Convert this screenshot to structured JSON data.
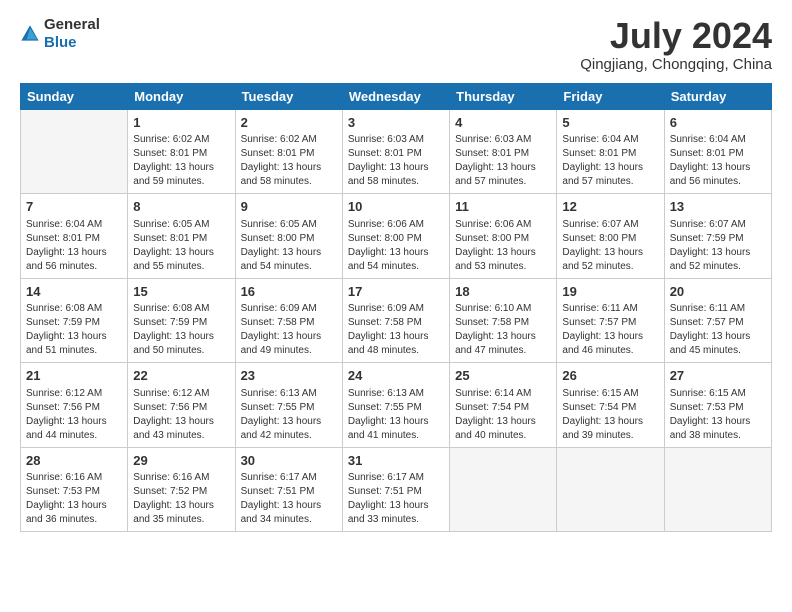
{
  "header": {
    "logo_general": "General",
    "logo_blue": "Blue",
    "month_year": "July 2024",
    "location": "Qingjiang, Chongqing, China"
  },
  "weekdays": [
    "Sunday",
    "Monday",
    "Tuesday",
    "Wednesday",
    "Thursday",
    "Friday",
    "Saturday"
  ],
  "weeks": [
    [
      {
        "day": "",
        "info": ""
      },
      {
        "day": "1",
        "info": "Sunrise: 6:02 AM\nSunset: 8:01 PM\nDaylight: 13 hours\nand 59 minutes."
      },
      {
        "day": "2",
        "info": "Sunrise: 6:02 AM\nSunset: 8:01 PM\nDaylight: 13 hours\nand 58 minutes."
      },
      {
        "day": "3",
        "info": "Sunrise: 6:03 AM\nSunset: 8:01 PM\nDaylight: 13 hours\nand 58 minutes."
      },
      {
        "day": "4",
        "info": "Sunrise: 6:03 AM\nSunset: 8:01 PM\nDaylight: 13 hours\nand 57 minutes."
      },
      {
        "day": "5",
        "info": "Sunrise: 6:04 AM\nSunset: 8:01 PM\nDaylight: 13 hours\nand 57 minutes."
      },
      {
        "day": "6",
        "info": "Sunrise: 6:04 AM\nSunset: 8:01 PM\nDaylight: 13 hours\nand 56 minutes."
      }
    ],
    [
      {
        "day": "7",
        "info": "Sunrise: 6:04 AM\nSunset: 8:01 PM\nDaylight: 13 hours\nand 56 minutes."
      },
      {
        "day": "8",
        "info": "Sunrise: 6:05 AM\nSunset: 8:01 PM\nDaylight: 13 hours\nand 55 minutes."
      },
      {
        "day": "9",
        "info": "Sunrise: 6:05 AM\nSunset: 8:00 PM\nDaylight: 13 hours\nand 54 minutes."
      },
      {
        "day": "10",
        "info": "Sunrise: 6:06 AM\nSunset: 8:00 PM\nDaylight: 13 hours\nand 54 minutes."
      },
      {
        "day": "11",
        "info": "Sunrise: 6:06 AM\nSunset: 8:00 PM\nDaylight: 13 hours\nand 53 minutes."
      },
      {
        "day": "12",
        "info": "Sunrise: 6:07 AM\nSunset: 8:00 PM\nDaylight: 13 hours\nand 52 minutes."
      },
      {
        "day": "13",
        "info": "Sunrise: 6:07 AM\nSunset: 7:59 PM\nDaylight: 13 hours\nand 52 minutes."
      }
    ],
    [
      {
        "day": "14",
        "info": "Sunrise: 6:08 AM\nSunset: 7:59 PM\nDaylight: 13 hours\nand 51 minutes."
      },
      {
        "day": "15",
        "info": "Sunrise: 6:08 AM\nSunset: 7:59 PM\nDaylight: 13 hours\nand 50 minutes."
      },
      {
        "day": "16",
        "info": "Sunrise: 6:09 AM\nSunset: 7:58 PM\nDaylight: 13 hours\nand 49 minutes."
      },
      {
        "day": "17",
        "info": "Sunrise: 6:09 AM\nSunset: 7:58 PM\nDaylight: 13 hours\nand 48 minutes."
      },
      {
        "day": "18",
        "info": "Sunrise: 6:10 AM\nSunset: 7:58 PM\nDaylight: 13 hours\nand 47 minutes."
      },
      {
        "day": "19",
        "info": "Sunrise: 6:11 AM\nSunset: 7:57 PM\nDaylight: 13 hours\nand 46 minutes."
      },
      {
        "day": "20",
        "info": "Sunrise: 6:11 AM\nSunset: 7:57 PM\nDaylight: 13 hours\nand 45 minutes."
      }
    ],
    [
      {
        "day": "21",
        "info": "Sunrise: 6:12 AM\nSunset: 7:56 PM\nDaylight: 13 hours\nand 44 minutes."
      },
      {
        "day": "22",
        "info": "Sunrise: 6:12 AM\nSunset: 7:56 PM\nDaylight: 13 hours\nand 43 minutes."
      },
      {
        "day": "23",
        "info": "Sunrise: 6:13 AM\nSunset: 7:55 PM\nDaylight: 13 hours\nand 42 minutes."
      },
      {
        "day": "24",
        "info": "Sunrise: 6:13 AM\nSunset: 7:55 PM\nDaylight: 13 hours\nand 41 minutes."
      },
      {
        "day": "25",
        "info": "Sunrise: 6:14 AM\nSunset: 7:54 PM\nDaylight: 13 hours\nand 40 minutes."
      },
      {
        "day": "26",
        "info": "Sunrise: 6:15 AM\nSunset: 7:54 PM\nDaylight: 13 hours\nand 39 minutes."
      },
      {
        "day": "27",
        "info": "Sunrise: 6:15 AM\nSunset: 7:53 PM\nDaylight: 13 hours\nand 38 minutes."
      }
    ],
    [
      {
        "day": "28",
        "info": "Sunrise: 6:16 AM\nSunset: 7:53 PM\nDaylight: 13 hours\nand 36 minutes."
      },
      {
        "day": "29",
        "info": "Sunrise: 6:16 AM\nSunset: 7:52 PM\nDaylight: 13 hours\nand 35 minutes."
      },
      {
        "day": "30",
        "info": "Sunrise: 6:17 AM\nSunset: 7:51 PM\nDaylight: 13 hours\nand 34 minutes."
      },
      {
        "day": "31",
        "info": "Sunrise: 6:17 AM\nSunset: 7:51 PM\nDaylight: 13 hours\nand 33 minutes."
      },
      {
        "day": "",
        "info": ""
      },
      {
        "day": "",
        "info": ""
      },
      {
        "day": "",
        "info": ""
      }
    ]
  ]
}
